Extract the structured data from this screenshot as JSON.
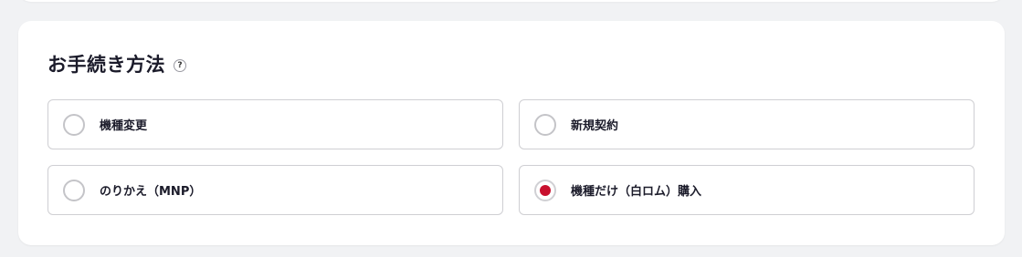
{
  "section": {
    "title": "お手続き方法",
    "help_icon_glyph": "?"
  },
  "options": [
    {
      "label": "機種変更",
      "selected": false
    },
    {
      "label": "新規契約",
      "selected": false
    },
    {
      "label": "のりかえ（MNP）",
      "selected": false
    },
    {
      "label": "機種だけ（白ロム）購入",
      "selected": true
    }
  ],
  "colors": {
    "selected_radio": "#c8102e",
    "title_text": "#1b1b2a",
    "page_background": "#f1f2f4"
  }
}
